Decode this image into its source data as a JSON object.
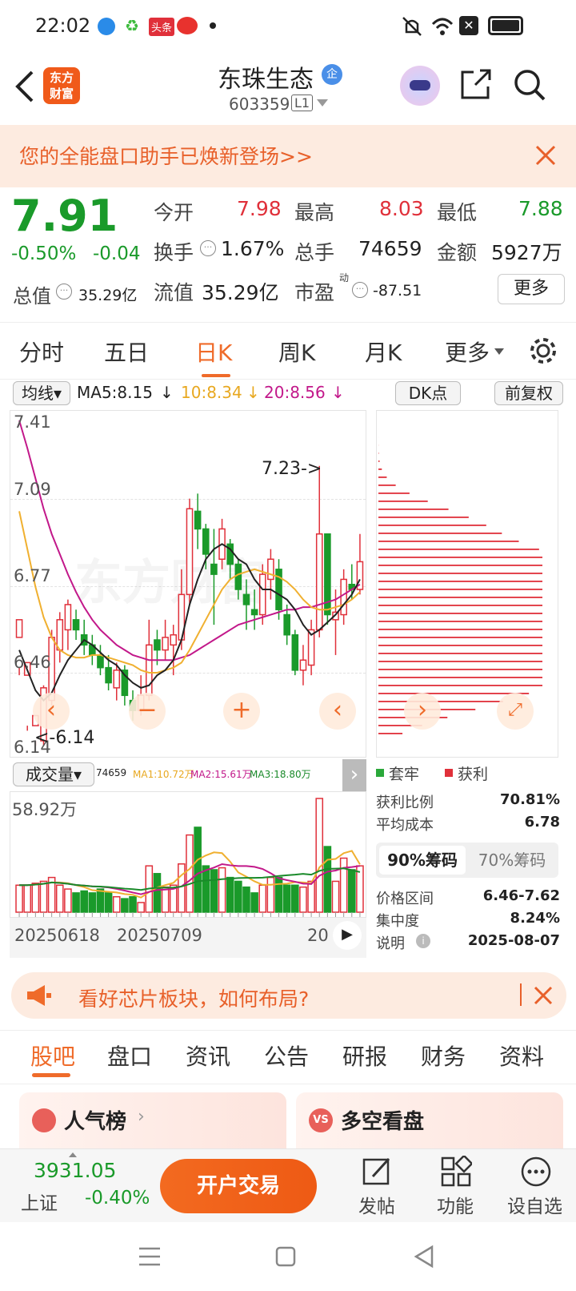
{
  "status": {
    "time": "22:02",
    "app_badge": "头条"
  },
  "header": {
    "logo_line1": "东方",
    "logo_line2": "财富",
    "stock_name": "东珠生态",
    "tag": "企",
    "code": "603359",
    "board": "L1"
  },
  "banner": {
    "text": "您的全能盘口助手已焕新登场>>"
  },
  "quote": {
    "price": "7.91",
    "pct": "-0.50%",
    "chg": "-0.04",
    "open_label": "今开",
    "open": "7.98",
    "high_label": "最高",
    "high": "8.03",
    "low_label": "最低",
    "low": "7.88",
    "turnover_label": "换手",
    "turnover": "1.67%",
    "volume_label": "总手",
    "volume": "74659",
    "amount_label": "金额",
    "amount": "5927万",
    "mktcap_label": "总值",
    "mktcap": "35.29亿",
    "float_label": "流值",
    "float": "35.29亿",
    "pe_label": "市盈",
    "pe_sup": "动",
    "pe": "-87.51",
    "more_label": "更多"
  },
  "tabs": [
    "分时",
    "五日",
    "日K",
    "周K",
    "月K",
    "更多"
  ],
  "active_tab": "日K",
  "chart_controls": {
    "indicator": "均线",
    "ma5": "MA5:8.15",
    "ma10": "10:8.34",
    "ma20": "20:8.56",
    "dk": "DK点",
    "adjust": "前复权"
  },
  "kline": {
    "y_labels": [
      "7.41",
      "7.09",
      "6.77",
      "6.46",
      "6.14"
    ],
    "max_annotation": "7.23->",
    "min_annotation": "<-6.14"
  },
  "volume": {
    "selector": "成交量",
    "vol": "74659",
    "ma1": "MA1:10.72万",
    "ma2": "MA2:15.61万",
    "ma3": "MA3:18.80万",
    "y_label": "58.92万"
  },
  "dates": [
    "20250618",
    "20250709",
    "20"
  ],
  "chips": {
    "legend_trapped": "套牢",
    "legend_profit": "获利",
    "rows": [
      {
        "label": "获利比例",
        "value": "70.81%"
      },
      {
        "label": "平均成本",
        "value": "6.78"
      }
    ],
    "tab90": "90%筹码",
    "tab70": "70%筹码",
    "rows2": [
      {
        "label": "价格区间",
        "value": "6.46-7.62"
      },
      {
        "label": "集中度",
        "value": "8.24%"
      },
      {
        "label": "说明",
        "value": "2025-08-07"
      }
    ]
  },
  "promo": {
    "text": "看好芯片板块，如何布局?"
  },
  "subtabs": [
    "股吧",
    "盘口",
    "资讯",
    "公告",
    "研报",
    "财务",
    "资料"
  ],
  "cards": [
    {
      "title": "人气榜"
    },
    {
      "title": "多空看盘"
    }
  ],
  "bottom": {
    "index_value": "3931.05",
    "index_name": "上证",
    "index_pct": "-0.40%",
    "trade_button": "开户交易",
    "actions": [
      "发帖",
      "功能",
      "设自选"
    ]
  },
  "colors": {
    "up": "#e0303a",
    "down": "#1a9a2a",
    "accent": "#ef6b2a"
  },
  "chart_data": {
    "type": "candlestick",
    "ylim": [
      6.14,
      7.41
    ],
    "candles": [
      [
        6.55,
        6.62,
        6.43,
        6.4
      ],
      [
        6.4,
        6.45,
        6.2,
        6.18
      ],
      [
        6.2,
        6.24,
        6.14,
        6.12
      ],
      [
        6.14,
        6.35,
        6.36,
        6.12
      ],
      [
        6.3,
        6.55,
        6.58,
        6.28
      ],
      [
        6.5,
        6.62,
        6.65,
        6.45
      ],
      [
        6.58,
        6.68,
        6.7,
        6.5
      ],
      [
        6.62,
        6.58,
        6.66,
        6.54
      ],
      [
        6.56,
        6.52,
        6.62,
        6.48
      ],
      [
        6.52,
        6.48,
        6.56,
        6.44
      ],
      [
        6.48,
        6.43,
        6.52,
        6.4
      ],
      [
        6.43,
        6.37,
        6.48,
        6.34
      ],
      [
        6.35,
        6.42,
        6.45,
        6.3
      ],
      [
        6.42,
        6.32,
        6.44,
        6.28
      ],
      [
        6.3,
        6.26,
        6.34,
        6.22
      ],
      [
        6.26,
        6.32,
        6.4,
        6.24
      ],
      [
        6.32,
        6.52,
        6.62,
        6.3
      ],
      [
        6.54,
        6.5,
        6.58,
        6.44
      ],
      [
        6.5,
        6.55,
        6.62,
        6.46
      ],
      [
        6.52,
        6.56,
        6.6,
        6.4
      ],
      [
        6.54,
        6.72,
        6.82,
        6.5
      ],
      [
        6.72,
        7.06,
        7.1,
        6.68
      ],
      [
        7.05,
        6.98,
        7.12,
        6.9
      ],
      [
        6.98,
        6.88,
        7.0,
        6.82
      ],
      [
        6.84,
        6.8,
        6.98,
        6.6
      ],
      [
        6.86,
        6.98,
        7.02,
        6.82
      ],
      [
        6.92,
        6.84,
        6.94,
        6.78
      ],
      [
        6.84,
        6.74,
        6.86,
        6.7
      ],
      [
        6.72,
        6.68,
        6.78,
        6.58
      ],
      [
        6.66,
        6.64,
        6.74,
        6.58
      ],
      [
        6.64,
        6.8,
        6.84,
        6.6
      ],
      [
        6.78,
        6.86,
        6.9,
        6.7
      ],
      [
        6.82,
        6.66,
        6.86,
        6.62
      ],
      [
        6.64,
        6.56,
        6.68,
        6.52
      ],
      [
        6.56,
        6.42,
        6.58,
        6.4
      ],
      [
        6.42,
        6.46,
        6.52,
        6.36
      ],
      [
        6.44,
        6.58,
        6.62,
        6.4
      ],
      [
        6.58,
        6.96,
        7.23,
        6.55
      ],
      [
        6.96,
        6.64,
        6.96,
        6.6
      ],
      [
        6.62,
        6.65,
        6.74,
        6.48
      ],
      [
        6.64,
        6.78,
        6.82,
        6.6
      ],
      [
        6.76,
        6.74,
        6.84,
        6.7
      ],
      [
        6.74,
        6.85,
        6.96,
        6.72
      ]
    ],
    "ma5": [
      6.5,
      6.42,
      6.34,
      6.3,
      6.33,
      6.4,
      6.46,
      6.5,
      6.54,
      6.52,
      6.49,
      6.46,
      6.44,
      6.4,
      6.37,
      6.35,
      6.36,
      6.4,
      6.42,
      6.46,
      6.54,
      6.68,
      6.78,
      6.86,
      6.9,
      6.92,
      6.9,
      6.86,
      6.84,
      6.78,
      6.74,
      6.74,
      6.72,
      6.7,
      6.66,
      6.6,
      6.56,
      6.58,
      6.61,
      6.64,
      6.68,
      6.72,
      6.78
    ],
    "ma10": [
      7.05,
      6.9,
      6.75,
      6.63,
      6.55,
      6.5,
      6.48,
      6.47,
      6.47,
      6.48,
      6.48,
      6.47,
      6.46,
      6.45,
      6.44,
      6.42,
      6.41,
      6.41,
      6.42,
      6.43,
      6.45,
      6.5,
      6.56,
      6.62,
      6.68,
      6.74,
      6.78,
      6.8,
      6.81,
      6.82,
      6.81,
      6.8,
      6.79,
      6.77,
      6.74,
      6.7,
      6.67,
      6.66,
      6.66,
      6.67,
      6.68,
      6.7,
      6.73
    ],
    "ma20": [
      7.41,
      7.3,
      7.18,
      7.06,
      6.96,
      6.88,
      6.8,
      6.73,
      6.67,
      6.62,
      6.58,
      6.55,
      6.52,
      6.5,
      6.48,
      6.47,
      6.46,
      6.46,
      6.46,
      6.46,
      6.47,
      6.48,
      6.5,
      6.52,
      6.54,
      6.56,
      6.58,
      6.6,
      6.61,
      6.62,
      6.63,
      6.64,
      6.65,
      6.66,
      6.66,
      6.67,
      6.67,
      6.68,
      6.69,
      6.7,
      6.72,
      6.74,
      6.76
    ],
    "volumes": [
      14,
      14,
      15,
      16,
      18,
      14,
      12,
      10,
      11,
      10,
      12,
      10,
      8,
      7,
      8,
      5,
      24,
      20,
      13,
      14,
      25,
      40,
      44,
      24,
      22,
      23,
      18,
      16,
      13,
      10,
      14,
      18,
      18,
      14,
      14,
      13,
      16,
      58.92,
      34,
      16,
      28,
      22,
      24
    ]
  }
}
